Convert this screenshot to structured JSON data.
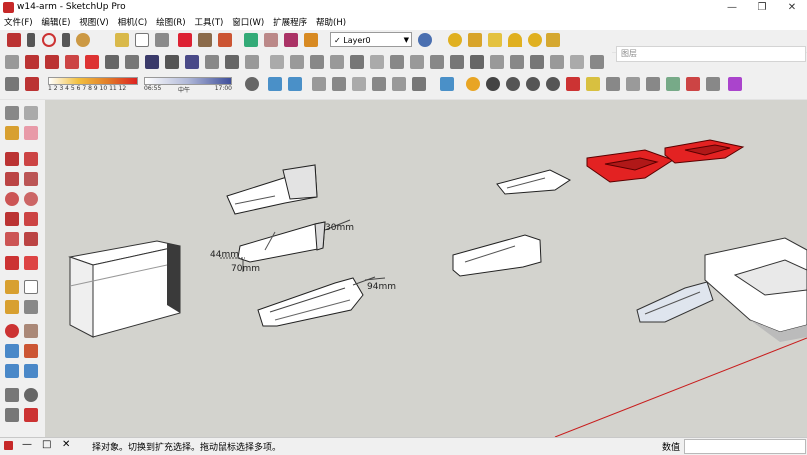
{
  "window": {
    "title": "w14-arm - SketchUp Pro"
  },
  "menu": [
    "文件(F)",
    "编辑(E)",
    "视图(V)",
    "相机(C)",
    "绘图(R)",
    "工具(T)",
    "窗口(W)",
    "扩展程序",
    "帮助(H)"
  ],
  "toolbar": {
    "layer_label": "Layer0"
  },
  "tray": {
    "tab_label": "图层"
  },
  "shadow": {
    "months": "1 2 3 4 5 6 7 8 9 10 11 12",
    "time_start": "06:55",
    "time_mid": "中午",
    "time_end": "17:00"
  },
  "dimensions": {
    "d1": "30mm",
    "d2": "44mm",
    "d3": "70mm",
    "d4": "94mm"
  },
  "status": {
    "message": "择对象。切换到扩充选择。拖动鼠标选择多项。",
    "measure_label": "数值",
    "measure_value": ""
  },
  "colors": {
    "selection": "#e32222",
    "viewport_bg": "#d3d3ce",
    "axis_red": "#c81d1d"
  }
}
